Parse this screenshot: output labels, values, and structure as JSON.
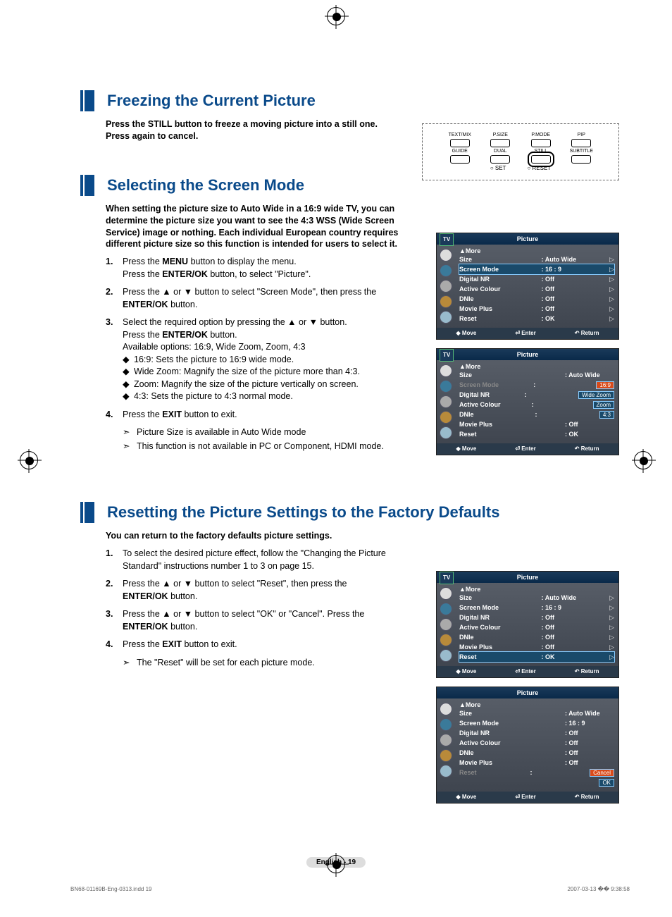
{
  "section1": {
    "title": "Freezing the Current Picture",
    "intro": "Press the STILL button to freeze a moving picture into a still one. Press again to cancel."
  },
  "remote": {
    "row1": [
      "TEXT/MIX",
      "P.SIZE",
      "P.MODE",
      "PIP"
    ],
    "row2": [
      "GUIDE",
      "DUAL",
      "STILL",
      "SUBTITLE"
    ],
    "row3": [
      "SET",
      "RESET"
    ]
  },
  "section2": {
    "title": "Selecting the Screen Mode",
    "intro": "When setting the picture size to Auto Wide in a 16:9 wide TV, you can determine the picture size you want to see the 4:3 WSS (Wide Screen Service) image or nothing. Each individual European country requires different picture size so this function is intended for users to select it.",
    "step1a": "Press the ",
    "step1b": "MENU",
    "step1c": " button to display the menu.",
    "step1d": "Press the ",
    "step1e": "ENTER/OK",
    "step1f": " button, to select \"Picture\".",
    "step2a": "Press the ▲ or ▼ button to select \"Screen Mode\", then press the ",
    "step2b": "ENTER/OK",
    "step2c": " button.",
    "step3a": "Select the required option by pressing the ▲ or ▼ button.",
    "step3b": "Press the ",
    "step3c": "ENTER/OK",
    "step3d": " button.",
    "step3e": "Available options: 16:9, Wide Zoom, Zoom, 4:3",
    "sub1": "16:9: Sets the picture to 16:9 wide mode.",
    "sub2": "Wide Zoom: Magnify the size of the picture more than 4:3.",
    "sub3": "Zoom: Magnify the size of the picture vertically on screen.",
    "sub4": "4:3: Sets the picture to 4:3 normal mode.",
    "step4a": "Press the ",
    "step4b": "EXIT",
    "step4c": " button to exit.",
    "note1": "Picture Size is available in Auto Wide mode",
    "note2": "This function is not available in PC or Component, HDMI mode."
  },
  "osd": {
    "tv": "TV",
    "title": "Picture",
    "more": "▲More",
    "items": [
      {
        "label": "Size",
        "value": ": Auto Wide"
      },
      {
        "label": "Screen Mode",
        "value": ": 16 : 9"
      },
      {
        "label": "Digital NR",
        "value": ": Off"
      },
      {
        "label": "Active Colour",
        "value": ": Off"
      },
      {
        "label": "DNIe",
        "value": ": Off"
      },
      {
        "label": "Movie Plus",
        "value": ": Off"
      },
      {
        "label": "Reset",
        "value": ": OK"
      }
    ],
    "foot_move": "Move",
    "foot_enter": "Enter",
    "foot_return": "Return",
    "dd": [
      "16:9",
      "Wide Zoom",
      "Zoom",
      "4:3"
    ]
  },
  "section3": {
    "title": "Resetting the Picture Settings to the Factory Defaults",
    "intro": "You can return to the factory defaults picture settings.",
    "step1": "To select the desired picture effect, follow the \"Changing the Picture Standard\" instructions number 1 to 3 on page 15.",
    "step2a": "Press the ▲ or ▼ button to select \"Reset\", then press the ",
    "step2b": "ENTER/OK",
    "step2c": " button.",
    "step3a": "Press the ▲ or ▼ button to select \"OK\" or \"Cancel\". Press the ",
    "step3b": "ENTER/OK",
    "step3c": " button.",
    "step4a": "Press the ",
    "step4b": "EXIT",
    "step4c": " button to exit.",
    "note1": "The \"Reset\" will be set for each picture mode."
  },
  "osd3_dd": [
    "Cancel",
    "OK"
  ],
  "pagenum": "English - 19",
  "footer_left": "BN68-01169B-Eng-0313.indd   19",
  "footer_right": "2007-03-13   �� 9:38:58"
}
